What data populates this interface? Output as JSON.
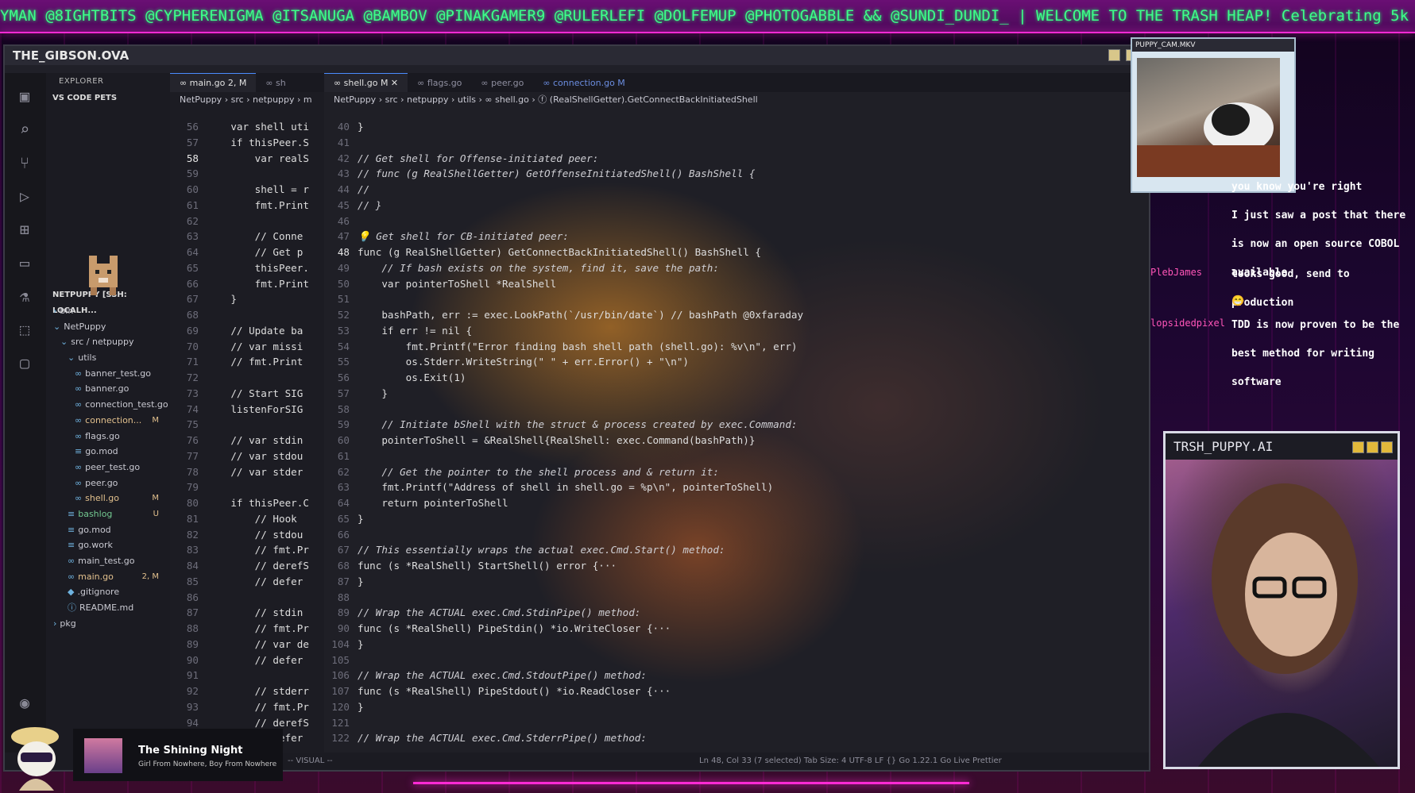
{
  "ticker": {
    "text": "YMAN @8IGHTBITS @CYPHERENIGMA @ITSANUGA @BAMBOV @PINAKGAMER9 @RULERLEFI @DOLFEMUP @PHOTOGABBLE && @SUNDI_DUNDI_ | WELCOME TO THE TRASH HEAP! Celebrating 5k Follow"
  },
  "vscode": {
    "title": "THE_GIBSON.OVA",
    "explorer": {
      "header": "EXPLORER",
      "pets_section": "VS CODE PETS",
      "remote_section": "NETPUPPY [SSH: LOCALH...",
      "items": [
        {
          "label": "bin",
          "indent": 1,
          "marker": "›",
          "state": ""
        },
        {
          "label": "NetPuppy",
          "indent": 1,
          "marker": "⌄",
          "state": ""
        },
        {
          "label": "src / netpuppy",
          "indent": 2,
          "marker": "⌄",
          "state": ""
        },
        {
          "label": "utils",
          "indent": 3,
          "marker": "⌄",
          "state": ""
        },
        {
          "label": "banner_test.go",
          "indent": 4,
          "marker": "∞",
          "state": ""
        },
        {
          "label": "banner.go",
          "indent": 4,
          "marker": "∞",
          "state": ""
        },
        {
          "label": "connection_test.go",
          "indent": 4,
          "marker": "∞",
          "state": ""
        },
        {
          "label": "connection...",
          "indent": 4,
          "marker": "∞",
          "state": "M"
        },
        {
          "label": "flags.go",
          "indent": 4,
          "marker": "∞",
          "state": ""
        },
        {
          "label": "go.mod",
          "indent": 4,
          "marker": "≡",
          "state": ""
        },
        {
          "label": "peer_test.go",
          "indent": 4,
          "marker": "∞",
          "state": ""
        },
        {
          "label": "peer.go",
          "indent": 4,
          "marker": "∞",
          "state": ""
        },
        {
          "label": "shell.go",
          "indent": 4,
          "marker": "∞",
          "state": "M"
        },
        {
          "label": "bashlog",
          "indent": 3,
          "marker": "≡",
          "state": "U"
        },
        {
          "label": "go.mod",
          "indent": 3,
          "marker": "≡",
          "state": ""
        },
        {
          "label": "go.work",
          "indent": 3,
          "marker": "≡",
          "state": ""
        },
        {
          "label": "main_test.go",
          "indent": 3,
          "marker": "∞",
          "state": ""
        },
        {
          "label": "main.go",
          "indent": 3,
          "marker": "∞",
          "state": "2, M"
        },
        {
          "label": ".gitignore",
          "indent": 3,
          "marker": "◆",
          "state": ""
        },
        {
          "label": "README.md",
          "indent": 3,
          "marker": "ⓘ",
          "state": ""
        },
        {
          "label": "pkg",
          "indent": 1,
          "marker": "›",
          "state": ""
        }
      ]
    },
    "left_editor": {
      "tabs": [
        {
          "label": "∞ main.go 2, M"
        },
        {
          "label": "∞ sh"
        }
      ],
      "breadcrumb": "NetPuppy › src › netpuppy › m",
      "lines": [
        {
          "n": "56",
          "code": "    var shell uti"
        },
        {
          "n": "57",
          "code": "    if thisPeer.S"
        },
        {
          "n": "58",
          "code": "        var realS"
        },
        {
          "n": "59",
          "code": ""
        },
        {
          "n": "60",
          "code": "        shell = r"
        },
        {
          "n": "61",
          "code": "        fmt.Print"
        },
        {
          "n": "62",
          "code": ""
        },
        {
          "n": "63",
          "code": "        // Conne"
        },
        {
          "n": "64",
          "code": "        // Get p"
        },
        {
          "n": "65",
          "code": "        thisPeer."
        },
        {
          "n": "66",
          "code": "        fmt.Print"
        },
        {
          "n": "67",
          "code": "    }"
        },
        {
          "n": "68",
          "code": ""
        },
        {
          "n": "69",
          "code": "    // Update ba"
        },
        {
          "n": "70",
          "code": "    // var missi"
        },
        {
          "n": "71",
          "code": "    // fmt.Print"
        },
        {
          "n": "72",
          "code": ""
        },
        {
          "n": "73",
          "code": "    // Start SIG"
        },
        {
          "n": "74",
          "code": "    listenForSIG"
        },
        {
          "n": "75",
          "code": ""
        },
        {
          "n": "76",
          "code": "    // var stdin"
        },
        {
          "n": "77",
          "code": "    // var stdou"
        },
        {
          "n": "78",
          "code": "    // var stder"
        },
        {
          "n": "79",
          "code": ""
        },
        {
          "n": "80",
          "code": "    if thisPeer.C"
        },
        {
          "n": "81",
          "code": "        // Hook "
        },
        {
          "n": "82",
          "code": "        // stdou"
        },
        {
          "n": "83",
          "code": "        // fmt.Pr"
        },
        {
          "n": "84",
          "code": "        // derefS"
        },
        {
          "n": "85",
          "code": "        // defer "
        },
        {
          "n": "86",
          "code": ""
        },
        {
          "n": "87",
          "code": "        // stdin"
        },
        {
          "n": "88",
          "code": "        // fmt.Pr"
        },
        {
          "n": "89",
          "code": "        // var de"
        },
        {
          "n": "90",
          "code": "        // defer "
        },
        {
          "n": "91",
          "code": ""
        },
        {
          "n": "92",
          "code": "        // stderr"
        },
        {
          "n": "93",
          "code": "        // fmt.Pr"
        },
        {
          "n": "94",
          "code": "        // derefS"
        },
        {
          "n": "95",
          "code": "        // defer "
        }
      ]
    },
    "right_editor": {
      "tabs": [
        {
          "label": "∞ shell.go M ✕",
          "kind": "active"
        },
        {
          "label": "∞ flags.go",
          "kind": ""
        },
        {
          "label": "∞ peer.go",
          "kind": ""
        },
        {
          "label": "∞ connection.go M",
          "kind": "blue"
        }
      ],
      "breadcrumb": "NetPuppy › src › netpuppy › utils › ∞ shell.go › ⓕ (RealShellGetter).GetConnectBackInitiatedShell",
      "lines": [
        {
          "n": "40",
          "code": "}",
          "cls": "t"
        },
        {
          "n": "41",
          "code": "",
          "cls": "t"
        },
        {
          "n": "42",
          "code": "// Get shell for Offense-initiated peer:",
          "cls": "c"
        },
        {
          "n": "43",
          "code": "// func (g RealShellGetter) GetOffenseInitiatedShell() BashShell {",
          "cls": "c"
        },
        {
          "n": "44",
          "code": "//",
          "cls": "c"
        },
        {
          "n": "45",
          "code": "// }",
          "cls": "c"
        },
        {
          "n": "46",
          "code": "",
          "cls": "t"
        },
        {
          "n": "47",
          "code": "💡 Get shell for CB-initiated peer:",
          "cls": "c"
        },
        {
          "n": "48",
          "code": "func (g RealShellGetter) GetConnectBackInitiatedShell() BashShell {",
          "cls": "t"
        },
        {
          "n": "49",
          "code": "    // If bash exists on the system, find it, save the path:",
          "cls": "c"
        },
        {
          "n": "50",
          "code": "    var pointerToShell *RealShell",
          "cls": "t"
        },
        {
          "n": "51",
          "code": "",
          "cls": "t"
        },
        {
          "n": "52",
          "code": "    bashPath, err := exec.LookPath(`/usr/bin/date`) // bashPath @0xfaraday",
          "cls": "t"
        },
        {
          "n": "53",
          "code": "    if err != nil {",
          "cls": "t"
        },
        {
          "n": "54",
          "code": "        fmt.Printf(\"Error finding bash shell path (shell.go): %v\\n\", err)",
          "cls": "t"
        },
        {
          "n": "55",
          "code": "        os.Stderr.WriteString(\" \" + err.Error() + \"\\n\")",
          "cls": "t"
        },
        {
          "n": "56",
          "code": "        os.Exit(1)",
          "cls": "t"
        },
        {
          "n": "57",
          "code": "    }",
          "cls": "t"
        },
        {
          "n": "58",
          "code": "",
          "cls": "t"
        },
        {
          "n": "59",
          "code": "    // Initiate bShell with the struct & process created by exec.Command:",
          "cls": "c"
        },
        {
          "n": "60",
          "code": "    pointerToShell = &RealShell{RealShell: exec.Command(bashPath)}",
          "cls": "t"
        },
        {
          "n": "61",
          "code": "",
          "cls": "t"
        },
        {
          "n": "62",
          "code": "    // Get the pointer to the shell process and & return it:",
          "cls": "c"
        },
        {
          "n": "63",
          "code": "    fmt.Printf(\"Address of shell in shell.go = %p\\n\", pointerToShell)",
          "cls": "t"
        },
        {
          "n": "64",
          "code": "    return pointerToShell",
          "cls": "t"
        },
        {
          "n": "65",
          "code": "}",
          "cls": "t"
        },
        {
          "n": "66",
          "code": "",
          "cls": "t"
        },
        {
          "n": "67",
          "code": "// This essentially wraps the actual exec.Cmd.Start() method:",
          "cls": "c"
        },
        {
          "n": "68",
          "code": "func (s *RealShell) StartShell() error {···",
          "cls": "t"
        },
        {
          "n": "87",
          "code": "}",
          "cls": "t"
        },
        {
          "n": "88",
          "code": "",
          "cls": "t"
        },
        {
          "n": "89",
          "code": "// Wrap the ACTUAL exec.Cmd.StdinPipe() method:",
          "cls": "c"
        },
        {
          "n": "90",
          "code": "func (s *RealShell) PipeStdin() *io.WriteCloser {···",
          "cls": "t"
        },
        {
          "n": "104",
          "code": "}",
          "cls": "t"
        },
        {
          "n": "105",
          "code": "",
          "cls": "t"
        },
        {
          "n": "106",
          "code": "// Wrap the ACTUAL exec.Cmd.StdoutPipe() method:",
          "cls": "c"
        },
        {
          "n": "107",
          "code": "func (s *RealShell) PipeStdout() *io.ReadCloser {···",
          "cls": "t"
        },
        {
          "n": "120",
          "code": "}",
          "cls": "t"
        },
        {
          "n": "121",
          "code": "",
          "cls": "t"
        },
        {
          "n": "122",
          "code": "// Wrap the ACTUAL exec.Cmd.StderrPipe() method:",
          "cls": "c"
        }
      ]
    },
    "statusbar": {
      "left": "-- VISUAL --",
      "right": "Ln 48, Col 33 (7 selected)   Tab Size: 4   UTF-8   LF   {} Go   1.22.1   Go Live   Prettier"
    }
  },
  "puppy_cam": {
    "title": "PUPPY_CAM.MKV"
  },
  "chat": [
    {
      "user": "",
      "text": "you know you're right"
    },
    {
      "user": "",
      "text": "I just saw a post that there is now an open source COBOL available"
    },
    {
      "user": "PlebJames",
      "text": "looks good, send to production"
    },
    {
      "user": "",
      "text": "😁"
    },
    {
      "user": "lopsidedpixel",
      "text": "TDD is now proven to be the best method for writing software"
    }
  ],
  "ai_window": {
    "title": "TRSH_PUPPY.AI"
  },
  "music": {
    "title": "The Shining Night",
    "artist": "Girl From Nowhere, Boy From Nowhere"
  },
  "colors": {
    "neon": "#ff2ad4",
    "ticker_text": "#3dff8a",
    "chat_user": "#ff55b8"
  }
}
